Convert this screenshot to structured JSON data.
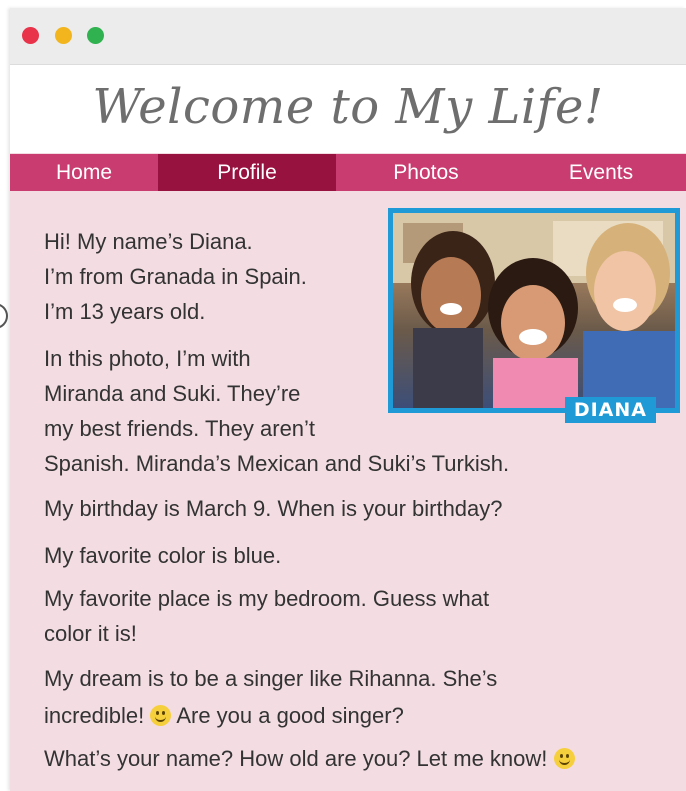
{
  "window": {
    "controls": [
      "close",
      "minimize",
      "maximize"
    ],
    "colors": {
      "close": "#e8334a",
      "minimize": "#f2b51d",
      "maximize": "#2fb24f"
    }
  },
  "header": {
    "title": "Welcome to My Life!"
  },
  "nav": {
    "tabs": [
      {
        "label": "Home"
      },
      {
        "label": "Profile",
        "active": true
      },
      {
        "label": "Photos"
      },
      {
        "label": "Events"
      }
    ],
    "colors": {
      "bar": "#c83c6f",
      "active": "#97123f"
    }
  },
  "photo": {
    "caption": "DIANA",
    "frame_color": "#1f9ad6"
  },
  "content": {
    "lines": [
      "Hi! My name’s Diana.",
      "I’m from Granada in Spain.",
      "I’m 13 years old.",
      "In this photo, I’m with",
      "Miranda and Suki. They’re",
      "my best friends. They aren’t",
      "Spanish. Miranda’s Mexican and Suki’s Turkish.",
      "My birthday is March 9. When is your birthday?",
      "My favorite color is blue.",
      "My favorite place is my bedroom. Guess what",
      "color it is!",
      "My dream is to be a singer like Rihanna. She’s",
      "incredible!",
      "Are you a good singer?",
      "What’s your name? How old are you? Let me know!"
    ]
  }
}
